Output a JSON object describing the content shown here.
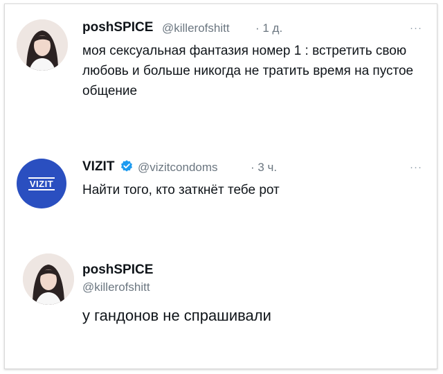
{
  "tweets": [
    {
      "display_name": "poshSPICE",
      "handle": "@killerofshitt",
      "time": "· 1 д.",
      "text": "моя сексуальная фантазия номер 1 : встретить свою любовь и больше никогда не тратить время на пустое общение",
      "more_icon": "more-dots-icon"
    },
    {
      "display_name": "VIZIT",
      "verified": true,
      "handle": "@vizitcondoms",
      "time": "· 3 ч.",
      "text": "Найти того, кто заткнёт тебе рот",
      "avatar_logo": "VIZIT",
      "more_icon": "more-dots-icon"
    },
    {
      "display_name": "poshSPICE",
      "handle": "@killerofshitt",
      "text": "у гандонов не спрашивали"
    }
  ],
  "colors": {
    "brand_blue": "#2a4fc0",
    "verified_blue": "#1d9bf0",
    "muted_text": "#6b7680"
  }
}
